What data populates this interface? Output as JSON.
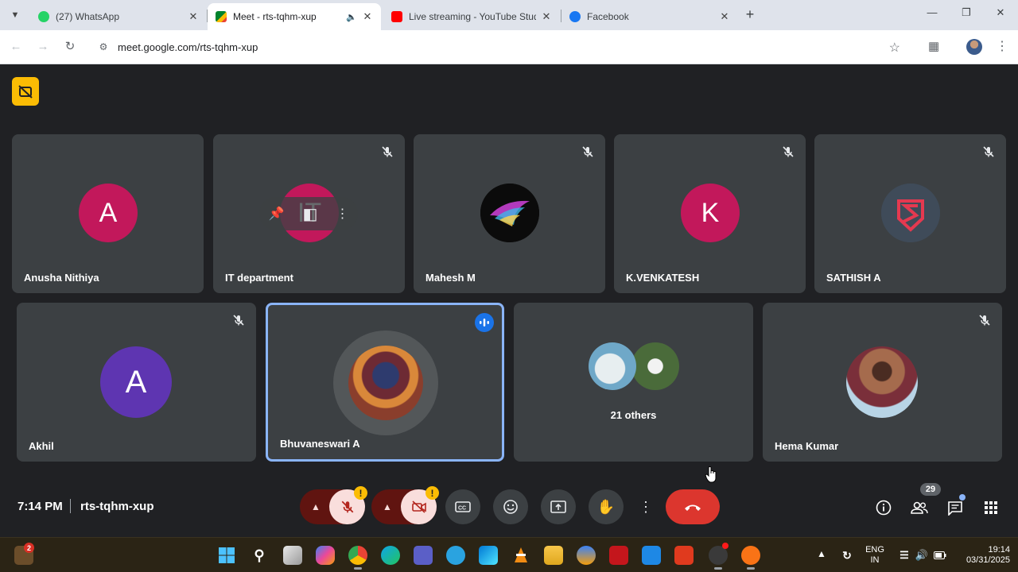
{
  "browser": {
    "tabs": [
      {
        "title": "(27) WhatsApp",
        "color": "#25d366"
      },
      {
        "title": "Meet - rts-tqhm-xup",
        "color": "#00832d"
      },
      {
        "title": "Live streaming - YouTube Studio",
        "color": "#ff0000"
      },
      {
        "title": "Facebook",
        "color": "#1877f2"
      }
    ],
    "new_tab_icon": "plus-icon",
    "url": "meet.google.com/rts-tqhm-xup"
  },
  "meet": {
    "participants_row1": [
      {
        "name": "Anusha Nithiya",
        "avatar_letter": "A",
        "avatar_color": "#c2185b",
        "muted": false
      },
      {
        "name": "IT department",
        "avatar_letter": "IT",
        "avatar_color": "#c2185b",
        "muted": true
      },
      {
        "name": "Mahesh M",
        "avatar_letter": "",
        "avatar_color": "#111111",
        "muted": true
      },
      {
        "name": "K.VENKATESH",
        "avatar_letter": "K",
        "avatar_color": "#c2185b",
        "muted": true
      },
      {
        "name": "SATHISH A",
        "avatar_letter": "",
        "avatar_color": "#3c4a5a",
        "muted": true
      }
    ],
    "participants_row2": [
      {
        "name": "Akhil",
        "avatar_letter": "A",
        "avatar_color": "#5e35b1",
        "muted": true
      },
      {
        "name": "Bhuvaneswari A",
        "speaking": true
      },
      {
        "name": "",
        "others_label": "21 others"
      },
      {
        "name": "Hema Kumar",
        "muted": true
      }
    ],
    "time": "7:14 PM",
    "meeting_code": "rts-tqhm-xup",
    "people_count": "29"
  },
  "taskbar": {
    "weather_badge": "2",
    "language": "ENG",
    "region": "IN",
    "clock_time": "19:14",
    "clock_date": "03/31/2025"
  }
}
